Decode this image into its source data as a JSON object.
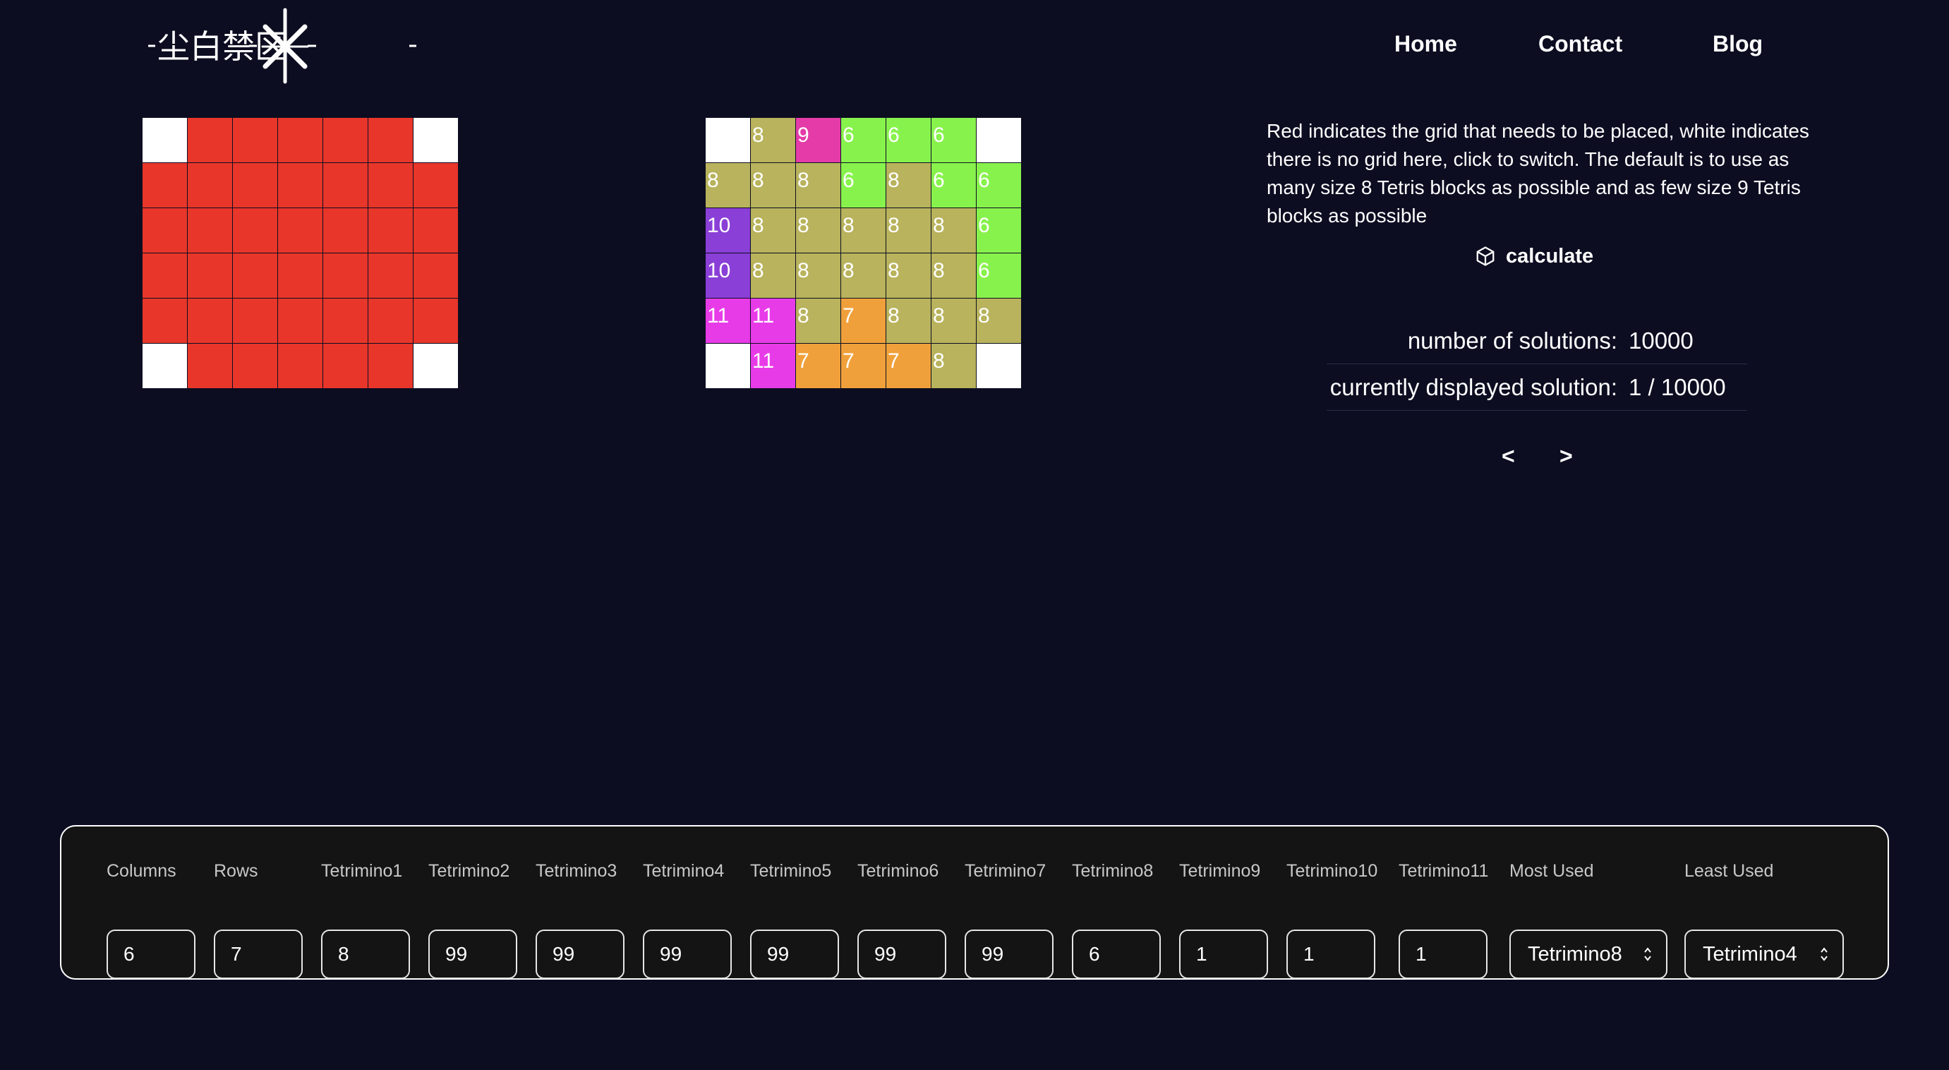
{
  "header": {
    "logo_text": "尘白禁区",
    "nav": [
      {
        "label": "Home"
      },
      {
        "label": "Contact"
      },
      {
        "label": "Blog"
      }
    ]
  },
  "colors": {
    "background": "#0c0d21",
    "required_cell": "#e8362a",
    "empty_cell": "#ffffff",
    "tetrimino6": "#88f24d",
    "tetrimino7": "#f0a03a",
    "tetrimino8": "#b8b35c",
    "tetrimino9": "#e43ba8",
    "tetrimino10": "#8a3fd6",
    "tetrimino11": "#e83be8"
  },
  "editor_grid": {
    "rows": [
      [
        "white",
        "red",
        "red",
        "red",
        "red",
        "red",
        "white"
      ],
      [
        "red",
        "red",
        "red",
        "red",
        "red",
        "red",
        "red"
      ],
      [
        "red",
        "red",
        "red",
        "red",
        "red",
        "red",
        "red"
      ],
      [
        "red",
        "red",
        "red",
        "red",
        "red",
        "red",
        "red"
      ],
      [
        "red",
        "red",
        "red",
        "red",
        "red",
        "red",
        "red"
      ],
      [
        "white",
        "red",
        "red",
        "red",
        "red",
        "red",
        "white"
      ]
    ]
  },
  "solution_grid": {
    "rows": [
      [
        "",
        "8",
        "9",
        "6",
        "6",
        "6",
        ""
      ],
      [
        "8",
        "8",
        "8",
        "6",
        "8",
        "6",
        "6"
      ],
      [
        "10",
        "8",
        "8",
        "8",
        "8",
        "8",
        "6"
      ],
      [
        "10",
        "8",
        "8",
        "8",
        "8",
        "8",
        "6"
      ],
      [
        "11",
        "11",
        "8",
        "7",
        "8",
        "8",
        "8"
      ],
      [
        "",
        "11",
        "7",
        "7",
        "7",
        "8",
        ""
      ]
    ]
  },
  "info": {
    "description": "Red indicates the grid that needs to be placed, white indicates there is no grid here, click to switch. The default is to use as many size 8 Tetris blocks as possible and as few size 9 Tetris blocks as possible",
    "calculate_label": "calculate",
    "solutions_label": "number of solutions:",
    "solutions_value": "10000",
    "current_label": "currently displayed solution:",
    "current_value": "1 / 10000",
    "prev_label": "<",
    "next_label": ">"
  },
  "form": {
    "fields": [
      {
        "label": "Columns",
        "value": "6"
      },
      {
        "label": "Rows",
        "value": "7"
      },
      {
        "label": "Tetrimino1",
        "value": "8"
      },
      {
        "label": "Tetrimino2",
        "value": "99"
      },
      {
        "label": "Tetrimino3",
        "value": "99"
      },
      {
        "label": "Tetrimino4",
        "value": "99"
      },
      {
        "label": "Tetrimino5",
        "value": "99"
      },
      {
        "label": "Tetrimino6",
        "value": "99"
      },
      {
        "label": "Tetrimino7",
        "value": "99"
      },
      {
        "label": "Tetrimino8",
        "value": "6"
      },
      {
        "label": "Tetrimino9",
        "value": "1"
      },
      {
        "label": "Tetrimino10",
        "value": "1"
      },
      {
        "label": "Tetrimino11",
        "value": "1"
      }
    ],
    "most_used": {
      "label": "Most Used",
      "value": "Tetrimino8"
    },
    "least_used": {
      "label": "Least Used",
      "value": "Tetrimino4"
    }
  }
}
